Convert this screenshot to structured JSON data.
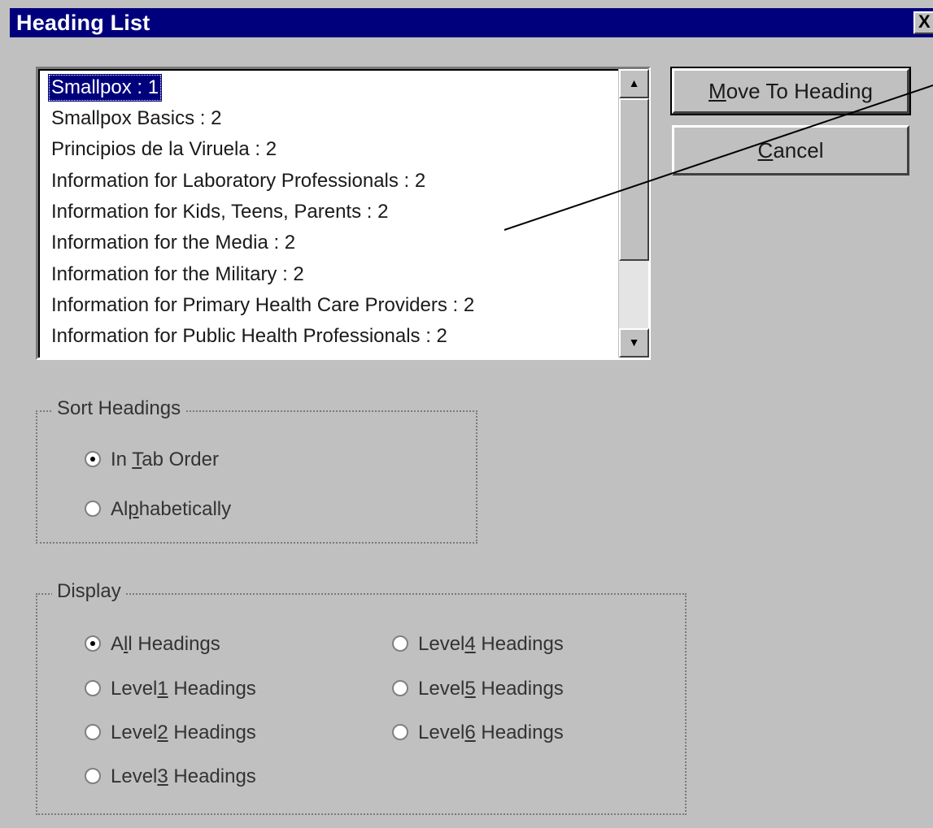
{
  "window": {
    "title": "Heading List",
    "close_label": "X"
  },
  "list": {
    "selected_index": 0,
    "items": [
      "Smallpox : 1",
      "Smallpox Basics : 2",
      "Principios de la Viruela : 2",
      "Information for Laboratory Professionals : 2",
      "Information for Kids, Teens, Parents : 2",
      "Information for the Media : 2",
      "Information for the Military : 2",
      "Information for Primary Health Care Providers : 2",
      "Information for Public Health Professionals : 2"
    ],
    "scroll_up_glyph": "▲",
    "scroll_down_glyph": "▼"
  },
  "buttons": {
    "move_to_heading": {
      "pre": "",
      "ul": "M",
      "post": "ove To Heading"
    },
    "cancel": {
      "pre": "",
      "ul": "C",
      "post": "ancel"
    }
  },
  "sort": {
    "label": "Sort Headings",
    "options": [
      {
        "pre": "In ",
        "ul": "T",
        "post": "ab Order",
        "checked": true
      },
      {
        "pre": "Al",
        "ul": "p",
        "post": "habetically",
        "checked": false
      }
    ]
  },
  "display": {
    "label": "Display",
    "options": [
      {
        "pre": "A",
        "ul": "l",
        "post": "l Headings",
        "checked": true
      },
      {
        "pre": "Level",
        "ul": "1",
        "post": " Headings",
        "checked": false
      },
      {
        "pre": "Level",
        "ul": "2",
        "post": " Headings",
        "checked": false
      },
      {
        "pre": "Level",
        "ul": "3",
        "post": " Headings",
        "checked": false
      },
      {
        "pre": "Level",
        "ul": "4",
        "post": " Headings",
        "checked": false
      },
      {
        "pre": "Level",
        "ul": "5",
        "post": " Headings",
        "checked": false
      },
      {
        "pre": "Level",
        "ul": "6",
        "post": " Headings",
        "checked": false
      }
    ]
  }
}
